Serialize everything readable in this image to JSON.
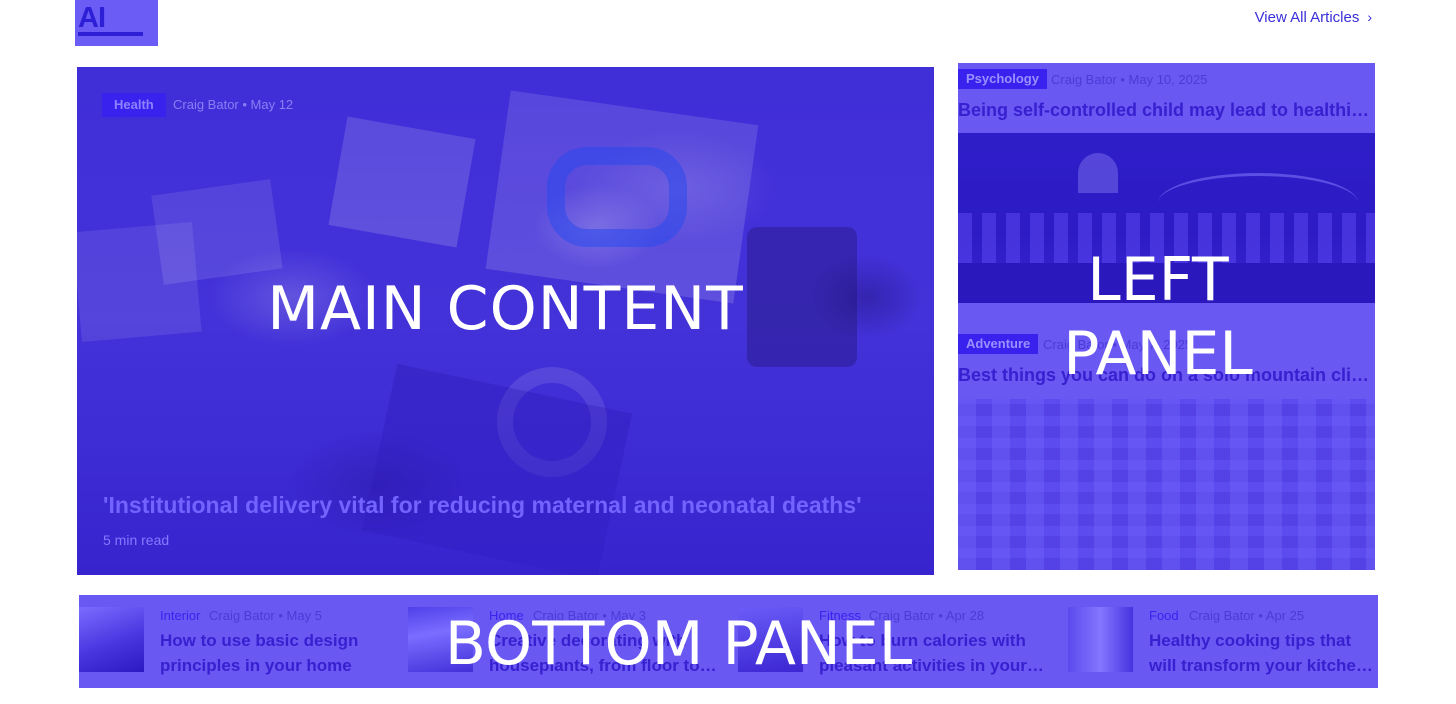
{
  "logo": {
    "text": "AI"
  },
  "header": {
    "view_all": "View All Articles",
    "chevron": "›"
  },
  "main": {
    "category": "Health",
    "meta": "Craig Bator • May 12",
    "region_label": "MAIN CONTENT",
    "title": "'Institutional delivery vital for reducing maternal and neonatal deaths'",
    "read_time": "5 min read"
  },
  "left_panel": {
    "region_label": "LEFT PANEL",
    "articles": [
      {
        "category": "Psychology",
        "meta": "Craig Bator • May 10, 2025",
        "title": "Being self-controlled child may lead to healthier aging"
      },
      {
        "category": "Adventure",
        "meta": "Craig Bator • May 7, 2025",
        "title": "Best things you can do on a solo mountain climb"
      }
    ]
  },
  "bottom_panel": {
    "region_label": "BOTTOM PANEL",
    "cards": [
      {
        "category": "Interior",
        "meta": "Craig Bator • May 5",
        "title": "How to use basic design principles in your home"
      },
      {
        "category": "Home",
        "meta": "Craig Bator • May 3",
        "title": "Creative decorating with houseplants, from floor to ceiling"
      },
      {
        "category": "Fitness",
        "meta": "Craig Bator • Apr 28",
        "title": "How to burn calories with pleasant activities in your day"
      },
      {
        "category": "Food",
        "meta": "Craig Bator • Apr 25",
        "title": "Healthy cooking tips that will transform your kitchen routine"
      }
    ]
  }
}
